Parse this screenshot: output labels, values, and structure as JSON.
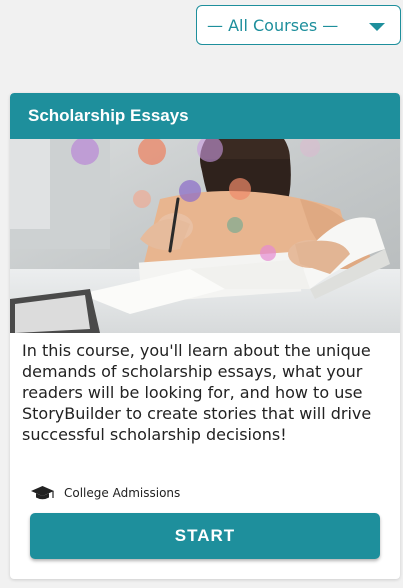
{
  "filter": {
    "selected": "— All Courses —"
  },
  "course": {
    "title": "Scholarship Essays",
    "description": "In this course, you'll learn about the unique demands of scholarship essays, what your readers will be looking for, and how to use StoryBuilder to create stories that will drive successful scholarship decisions!",
    "category": "College Admissions",
    "category_icon": "graduation-cap-icon",
    "cta_label": "START"
  },
  "colors": {
    "accent": "#1e8f9c",
    "background": "#f1f1f1"
  }
}
